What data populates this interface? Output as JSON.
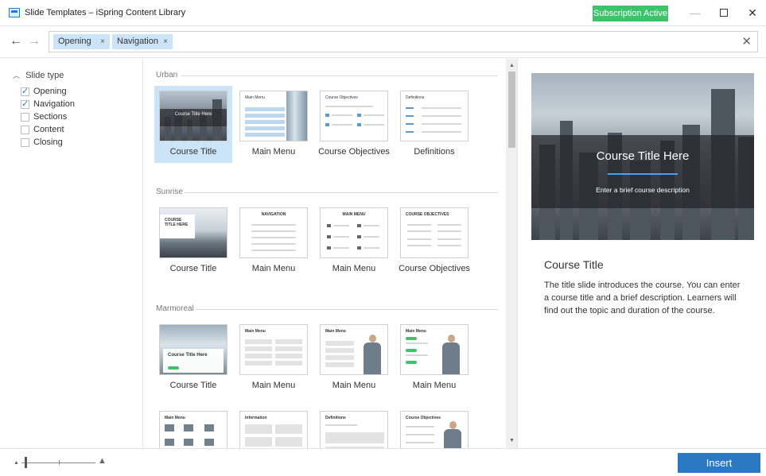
{
  "window": {
    "title": "Slide Templates – iSpring Content Library",
    "subscription_badge": "Subscription Active",
    "minimize_glyph": "—",
    "close_glyph": "✕"
  },
  "toolbar": {
    "back_icon": "←",
    "forward_icon": "→",
    "chips": [
      {
        "label": "Opening",
        "remove": "×"
      },
      {
        "label": "Navigation",
        "remove": "×"
      }
    ],
    "clear_icon": "✕"
  },
  "filters": {
    "heading": "Slide type",
    "collapse_glyph": "︿",
    "items": [
      {
        "label": "Opening",
        "checked": true
      },
      {
        "label": "Navigation",
        "checked": true
      },
      {
        "label": "Sections",
        "checked": false
      },
      {
        "label": "Content",
        "checked": false
      },
      {
        "label": "Closing",
        "checked": false
      }
    ]
  },
  "sections": [
    {
      "name": "Urban",
      "tiles": [
        {
          "label": "Course Title",
          "selected": true,
          "thumb_text": "Course Title Here"
        },
        {
          "label": "Main Menu",
          "thumb_text": "Main Menu"
        },
        {
          "label": "Course Objectives",
          "thumb_text": "Course Objectives"
        },
        {
          "label": "Definitions",
          "thumb_text": "Definitions"
        }
      ]
    },
    {
      "name": "Sunrise",
      "tiles": [
        {
          "label": "Course Title",
          "thumb_text": "COURSE TITLE HERE"
        },
        {
          "label": "Main Menu",
          "thumb_text": "NAVIGATION"
        },
        {
          "label": "Main Menu",
          "thumb_text": "MAIN MENU"
        },
        {
          "label": "Course Objectives",
          "thumb_text": "COURSE OBJECTIVES"
        }
      ]
    },
    {
      "name": "Marmoreal",
      "tiles": [
        {
          "label": "Course Title",
          "thumb_text": "Course Title Here"
        },
        {
          "label": "Main Menu",
          "thumb_text": "Main Menu"
        },
        {
          "label": "Main Menu",
          "thumb_text": "Main Menu"
        },
        {
          "label": "Main Menu",
          "thumb_text": "Main Menu"
        }
      ]
    },
    {
      "name": "",
      "tiles": [
        {
          "label": "",
          "thumb_text": "Main Menu"
        },
        {
          "label": "",
          "thumb_text": "Information"
        },
        {
          "label": "",
          "thumb_text": "Definitions"
        },
        {
          "label": "",
          "thumb_text": "Course Objectives"
        }
      ]
    }
  ],
  "preview": {
    "slide_title": "Course Title Here",
    "slide_subtitle": "Enter a brief course description",
    "heading": "Course Title",
    "description": "The title slide introduces the course. You can enter a course title and a brief description. Learners will find out the topic and duration of the course."
  },
  "bottom": {
    "insert_label": "Insert"
  }
}
